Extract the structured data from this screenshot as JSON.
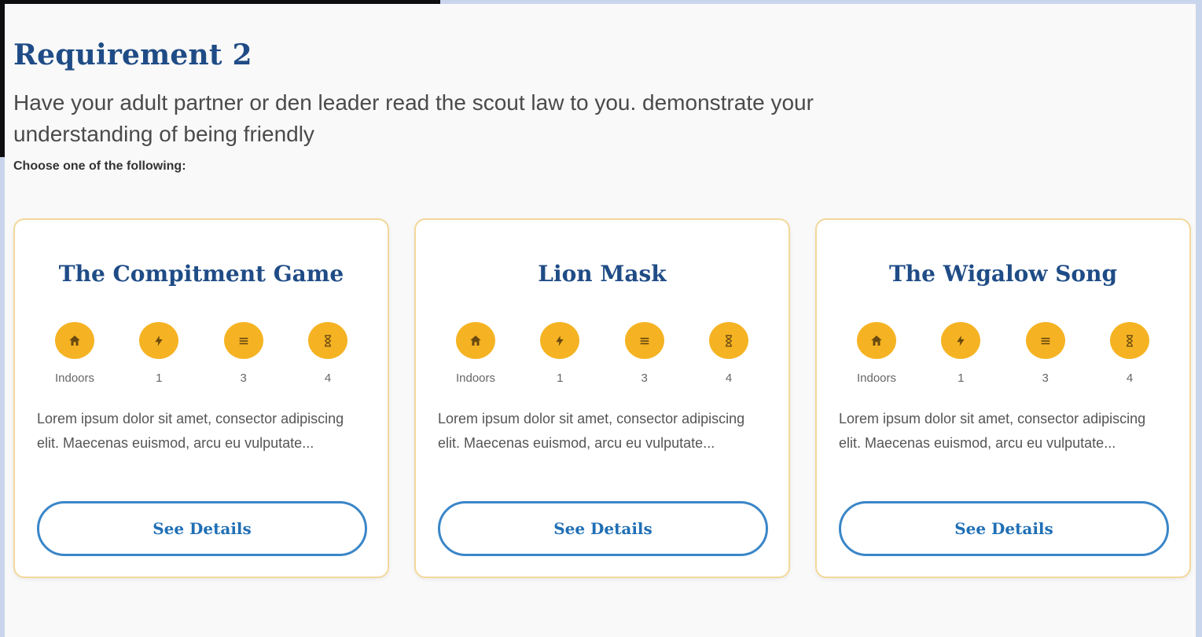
{
  "requirement": {
    "title": "Requirement 2",
    "description": "Have your adult partner or den leader read the scout law to you. demonstrate your understanding of being friendly",
    "choose_label": "Choose one of the following:"
  },
  "icons": [
    "home-icon",
    "lightning-icon",
    "list-icon",
    "hourglass-icon"
  ],
  "colors": {
    "accent": "#f5b323",
    "title": "#1f4c86",
    "button_border": "#3a86c8",
    "card_border": "#f3d89a"
  },
  "cards": [
    {
      "title": "The Compitment Game",
      "stats": [
        "Indoors",
        "1",
        "3",
        "4"
      ],
      "description": "Lorem ipsum dolor sit amet, consector adipiscing elit. Maecenas euismod, arcu eu vulputate...",
      "button_label": "See Details"
    },
    {
      "title": "Lion Mask",
      "stats": [
        "Indoors",
        "1",
        "3",
        "4"
      ],
      "description": "Lorem ipsum dolor sit amet, consector adipiscing elit. Maecenas euismod, arcu eu vulputate...",
      "button_label": "See Details"
    },
    {
      "title": "The Wigalow Song",
      "stats": [
        "Indoors",
        "1",
        "3",
        "4"
      ],
      "description": "Lorem ipsum dolor sit amet, consector adipiscing elit. Maecenas euismod, arcu eu vulputate...",
      "button_label": "See Details"
    }
  ]
}
